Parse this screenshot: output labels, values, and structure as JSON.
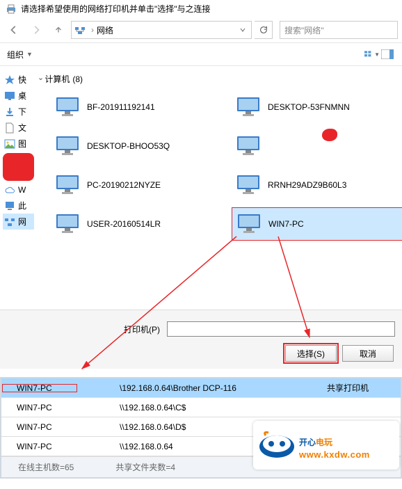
{
  "title": "请选择希望使用的网络打印机并单击\"选择\"与之连接",
  "nav": {
    "location_label": "网络"
  },
  "search": {
    "placeholder": "搜索\"网络\""
  },
  "toolbar": {
    "organize": "组织"
  },
  "group": {
    "header_prefix": "计算机",
    "header_count": "(8)"
  },
  "sidebar": {
    "items": [
      {
        "label": "快"
      },
      {
        "label": "桌"
      },
      {
        "label": "下"
      },
      {
        "label": "文"
      },
      {
        "label": "图"
      },
      {
        "label": "W"
      },
      {
        "label": "此"
      },
      {
        "label": "网"
      }
    ]
  },
  "computers": [
    {
      "name": "BF-201911192141"
    },
    {
      "name": "DESKTOP-53FNMNN"
    },
    {
      "name": "DESKTOP-BHOO53Q"
    },
    {
      "name": ""
    },
    {
      "name": "PC-20190212NYZE"
    },
    {
      "name": "RRNH29ADZ9B60L3"
    },
    {
      "name": "USER-20160514LR"
    },
    {
      "name": "WIN7-PC"
    }
  ],
  "form": {
    "printer_label": "打印机(P)",
    "printer_value": ""
  },
  "buttons": {
    "select": "选择(S)",
    "cancel": "取消"
  },
  "table": {
    "rows": [
      {
        "host": "WIN7-PC",
        "path": "\\192.168.0.64\\Brother DCP-116",
        "desc": "共享打印机"
      },
      {
        "host": "WIN7-PC",
        "path": "\\\\192.168.0.64\\C$",
        "desc": ""
      },
      {
        "host": "WIN7-PC",
        "path": "\\\\192.168.0.64\\D$",
        "desc": ""
      },
      {
        "host": "WIN7-PC",
        "path": "\\\\192.168.0.64",
        "desc": ""
      }
    ]
  },
  "status": {
    "hosts_label": "在线主机数=65",
    "shares_label": "共享文件夹数=4"
  },
  "watermark": {
    "brand_a": "开心",
    "brand_b": "电玩",
    "url": "www.kxdw.com"
  }
}
